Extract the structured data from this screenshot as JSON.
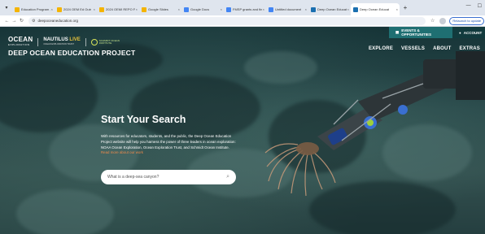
{
  "browser": {
    "tabs": [
      {
        "label": "Education Program -",
        "color": "#f4b400"
      },
      {
        "label": "2024 OEM Ed Outr",
        "color": "#f4b400"
      },
      {
        "label": "2024 OEMI REPO Fr",
        "color": "#f4b400"
      },
      {
        "label": "Google Slides",
        "color": "#f4b400"
      },
      {
        "label": "Google Docs",
        "color": "#4285f4"
      },
      {
        "label": "FMSP grants and fin",
        "color": "#4285f4"
      },
      {
        "label": "Untitled document",
        "color": "#4285f4"
      },
      {
        "label": "Deep Ocean Educati",
        "color": "#1a6fb0"
      },
      {
        "label": "Deep Ocean Educati",
        "color": "#1a6fb0",
        "active": true
      }
    ],
    "new_tab_label": "+",
    "url": "deepoceaneducation.org",
    "relaunch_label": "Relaunch to update"
  },
  "site": {
    "logos": {
      "ocean_exploration": "OCEAN",
      "ocean_exploration_sub": "EXPLORATION",
      "nautilus": "NAUTILUS",
      "nautilus_live": "LIVE",
      "nautilus_sub": "OCEAN EXPLORATION TRUST",
      "soi": "SCHMIDT OCEAN INSTITUTE"
    },
    "title": "DEEP OCEAN EDUCATION PROJECT",
    "top_buttons": {
      "events": "EVENTS & OPPORTUNITIES",
      "account": "ACCOUNT"
    },
    "nav": [
      "EXPLORE",
      "VESSELS",
      "ABOUT",
      "EXTRAS"
    ],
    "hero": {
      "heading": "Start Your Search",
      "intro": "With resources for educators, students, and the public, the Deep Ocean Education Project website will help you harness the power of three leaders in ocean exploration: NOAA Ocean Exploration, Ocean Exploration Trust, and Schmidt Ocean Institute.",
      "intro_link": "Read more about our work",
      "search_placeholder": "What is a deep-sea canyon?"
    }
  },
  "colors": {
    "events_button": "#1f6f72",
    "account_button": "#123a3d",
    "link": "#f08a4b"
  }
}
